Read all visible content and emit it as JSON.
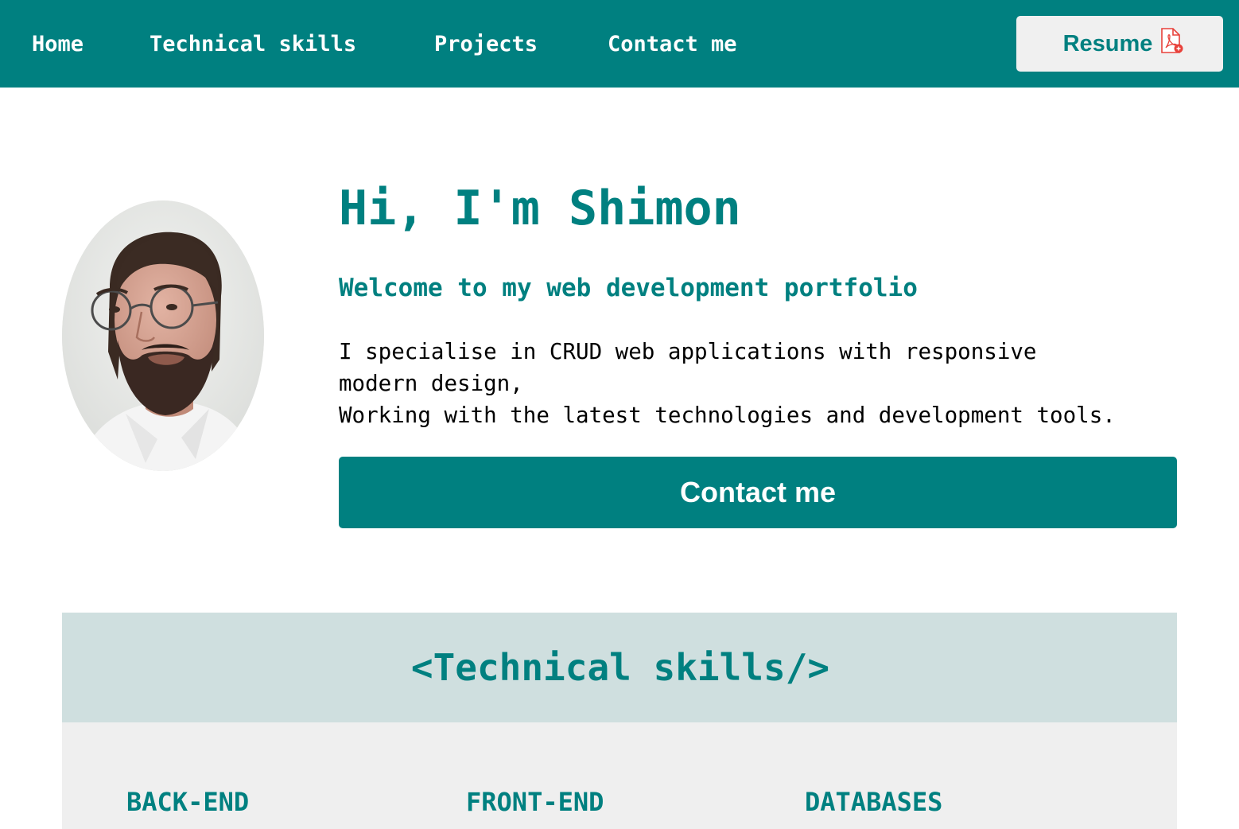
{
  "nav": {
    "links": [
      "Home",
      "Technical skills",
      "Projects",
      "Contact me"
    ],
    "resume_label": "Resume",
    "resume_icon": "pdf-icon"
  },
  "hero": {
    "title": "Hi, I'm Shimon",
    "subtitle": "Welcome to my web development portfolio",
    "text_lines": [
      "I specialise in CRUD web applications with responsive",
      "modern design,",
      "Working with the latest technologies and development tools."
    ],
    "contact_button": "Contact me"
  },
  "skills": {
    "title": "<Technical skills/>",
    "columns": [
      "BACK-END",
      "FRONT-END",
      "DATABASES"
    ]
  },
  "colors": {
    "brand": "#008080",
    "skills_header_bg": "#cfdfdf",
    "skills_body_bg": "#efefef",
    "resume_bg": "#f0f0f0",
    "pdf_icon": "#e8413a"
  }
}
